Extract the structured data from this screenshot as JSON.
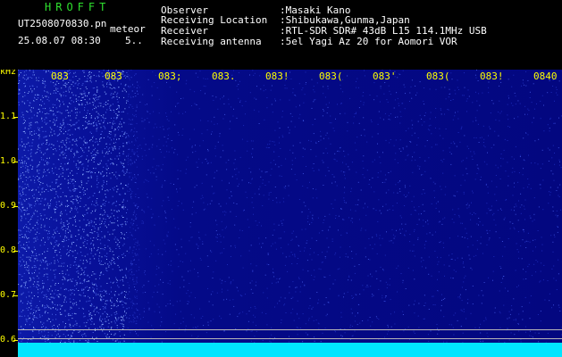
{
  "header": {
    "station": "HROFFT",
    "filename": "UT2508070830.pn",
    "mode": "meteor",
    "datetime": "25.08.07 08:30",
    "count": "5..",
    "labels": [
      "Observer",
      "Receiving Location",
      "Receiver",
      "Receiving antenna"
    ],
    "values": [
      ":Masaki Kano",
      ":Shibukawa,Gunma,Japan",
      ":RTL-SDR SDR# 43dB L15 114.1MHz USB",
      ":5el Yagi Az 20 for Aomori VOR"
    ]
  },
  "y_axis": {
    "unit": "kHz",
    "ticks": [
      "1.1",
      "1.0",
      "0.9",
      "0.8",
      "0.7",
      "0.6"
    ]
  },
  "x_axis": {
    "ticks": [
      "083",
      "083",
      "083;",
      "083.",
      "083!",
      "083(",
      "083'",
      "083(",
      "083!",
      "0840"
    ]
  },
  "colors": {
    "background": "#000000",
    "spectrogram": "#00008c",
    "noise_floor": "#00e5ff",
    "axis": "#ffff00",
    "station": "#2fe02f"
  }
}
